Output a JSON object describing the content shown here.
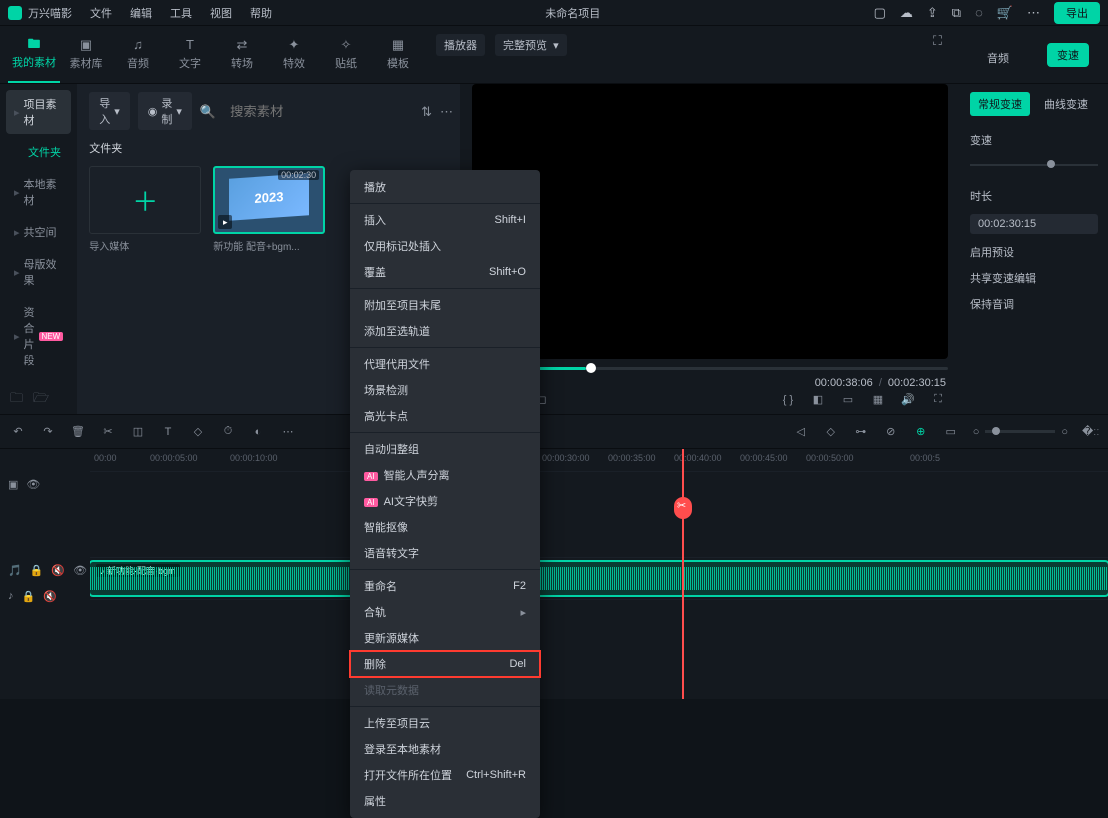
{
  "app": {
    "name": "万兴喵影",
    "project_title": "未命名项目"
  },
  "menus": [
    "文件",
    "编辑",
    "工具",
    "视图",
    "帮助"
  ],
  "export_label": "导出",
  "main_tabs": [
    {
      "label": "我的素材",
      "active": true
    },
    {
      "label": "素材库"
    },
    {
      "label": "音频"
    },
    {
      "label": "文字"
    },
    {
      "label": "转场"
    },
    {
      "label": "特效"
    },
    {
      "label": "贴纸"
    },
    {
      "label": "模板"
    }
  ],
  "sidebar": {
    "header": "项目素材",
    "items": [
      {
        "label": "文件夹",
        "active_green": true
      },
      {
        "label": "本地素材"
      },
      {
        "label": "共空间"
      },
      {
        "label": "母版效果"
      },
      {
        "label": "资合片段",
        "new": true
      }
    ]
  },
  "media": {
    "import_label": "导入",
    "sort_label": "录制",
    "search_placeholder": "搜索素材",
    "folder_label": "文件夹",
    "items": [
      {
        "name": "导入媒体",
        "type": "add"
      },
      {
        "name": "新功能 配音+bgm...",
        "type": "clip",
        "duration": "00:02:30",
        "thumb_text": "2023"
      }
    ]
  },
  "preview": {
    "mode_label": "播放器",
    "quality_label": "完整预览",
    "current_time": "00:00:38:06",
    "total_time": "00:02:30:15"
  },
  "inspector": {
    "top_tabs": [
      "音频",
      "变速"
    ],
    "top_active": 1,
    "sub_tabs": [
      "常规变速",
      "曲线变速"
    ],
    "sub_active": 0,
    "speed_label": "变速",
    "duration_label": "时长",
    "duration_value": "00:02:30:15",
    "links": [
      "启用预设",
      "共享变速编辑",
      "保持音调"
    ]
  },
  "timeline": {
    "ticks": [
      "00:00",
      "00:00:05:00",
      "00:00:10:00",
      "00:00:30:00",
      "00:00:35:00",
      "00:00:40:00",
      "00:00:45:00",
      "00:00:50:00",
      "00:00:5"
    ],
    "audio_clip_label": "新功能·配音·bgm"
  },
  "context_menu": {
    "groups": [
      [
        {
          "label": "播放"
        }
      ],
      [
        {
          "label": "插入",
          "shortcut": "Shift+I"
        },
        {
          "label": "仅用标记处插入"
        },
        {
          "label": "覆盖",
          "shortcut": "Shift+O"
        }
      ],
      [
        {
          "label": "附加至项目末尾"
        },
        {
          "label": "添加至选轨道"
        }
      ],
      [
        {
          "label": "代理代用文件"
        },
        {
          "label": "场景检测"
        },
        {
          "label": "高光卡点"
        }
      ],
      [
        {
          "label": "自动归整组"
        },
        {
          "label": "智能人声分离",
          "ai": true
        },
        {
          "label": "AI文字快剪",
          "ai": true
        },
        {
          "label": "智能抠像"
        },
        {
          "label": "语音转文字"
        }
      ],
      [
        {
          "label": "重命名",
          "shortcut": "F2"
        },
        {
          "label": "合轨",
          "arrow": true
        },
        {
          "label": "更新源媒体"
        },
        {
          "label": "删除",
          "shortcut": "Del",
          "highlight": true
        },
        {
          "label": "读取元数据",
          "disabled": true
        }
      ],
      [
        {
          "label": "上传至项目云"
        },
        {
          "label": "登录至本地素材"
        },
        {
          "label": "打开文件所在位置",
          "shortcut": "Ctrl+Shift+R"
        },
        {
          "label": "属性"
        }
      ]
    ]
  }
}
